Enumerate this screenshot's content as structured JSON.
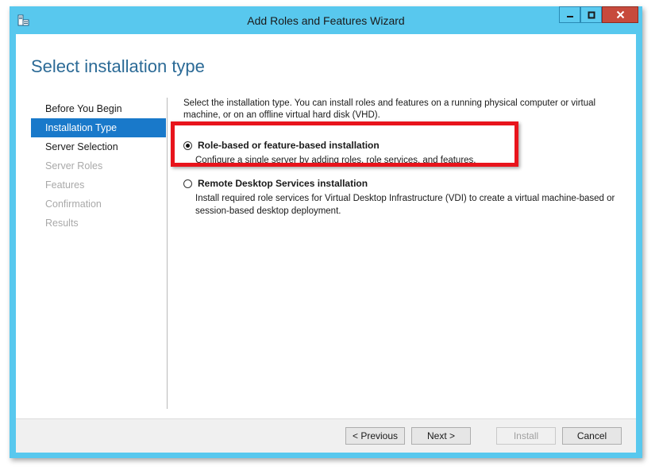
{
  "window": {
    "title": "Add Roles and Features Wizard",
    "icon": "server-manager-icon",
    "controls": {
      "minimize": "minimize-icon",
      "maximize": "maximize-icon",
      "close": "close-icon"
    },
    "frame_color": "#58c8ee"
  },
  "page": {
    "title": "Select installation type"
  },
  "nav": {
    "items": [
      {
        "label": "Before You Begin",
        "state": "normal"
      },
      {
        "label": "Installation Type",
        "state": "active"
      },
      {
        "label": "Server Selection",
        "state": "normal"
      },
      {
        "label": "Server Roles",
        "state": "disabled"
      },
      {
        "label": "Features",
        "state": "disabled"
      },
      {
        "label": "Confirmation",
        "state": "disabled"
      },
      {
        "label": "Results",
        "state": "disabled"
      }
    ],
    "active_color": "#1979ca"
  },
  "content": {
    "intro": "Select the installation type. You can install roles and features on a running physical computer or virtual machine, or on an offline virtual hard disk (VHD).",
    "options": [
      {
        "title": "Role-based or feature-based installation",
        "description": "Configure a single server by adding roles, role services, and features.",
        "selected": true
      },
      {
        "title": "Remote Desktop Services installation",
        "description": "Install required role services for Virtual Desktop Infrastructure (VDI) to create a virtual machine-based or session-based desktop deployment.",
        "selected": false
      }
    ],
    "highlight_color": "#e8141c"
  },
  "footer": {
    "previous_label": "< Previous",
    "next_label": "Next >",
    "install_label": "Install",
    "install_enabled": false,
    "cancel_label": "Cancel"
  }
}
